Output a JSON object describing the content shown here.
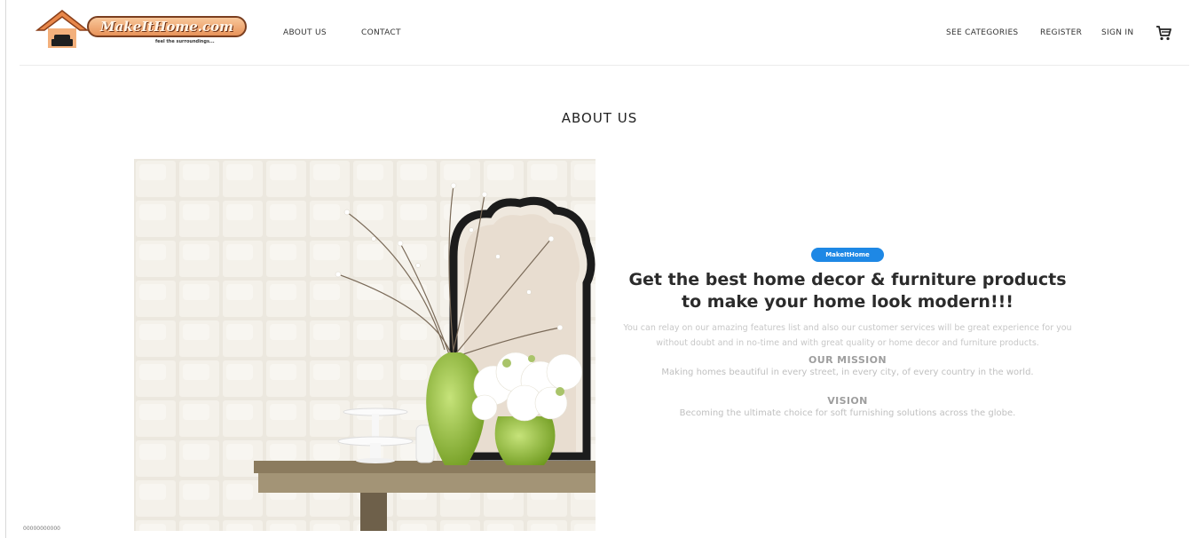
{
  "header": {
    "logo_text": "MakeItHome.com",
    "logo_tagline": "feel the surroundings...",
    "nav_left": [
      {
        "label": "ABOUT US"
      },
      {
        "label": "CONTACT"
      }
    ],
    "nav_right": [
      {
        "label": "SEE CATEGORIES"
      },
      {
        "label": "REGISTER"
      },
      {
        "label": "SIGN IN"
      }
    ],
    "cart_icon": "cart-icon"
  },
  "page": {
    "title": "ABOUT US"
  },
  "about": {
    "badge": "MakeItHome",
    "headline": "Get the best home decor & furniture products to make your home look modern!!!",
    "intro": "You can relay on our amazing features list and also our customer services will be great experience for you without doubt and in no-time and with great quality or home decor and furniture products.",
    "mission_title": "OUR MISSION",
    "mission_text": "Making homes beautiful in every street, in every city, of every country in the world.",
    "vision_title": "VISION",
    "vision_text": "Becoming the ultimate choice for soft furnishing solutions across the globe."
  },
  "colors": {
    "badge": "#1e88e5",
    "text_dark": "#2b2b2b",
    "text_light": "#c7c7c7"
  },
  "footer": {
    "mark": "00000000000"
  }
}
